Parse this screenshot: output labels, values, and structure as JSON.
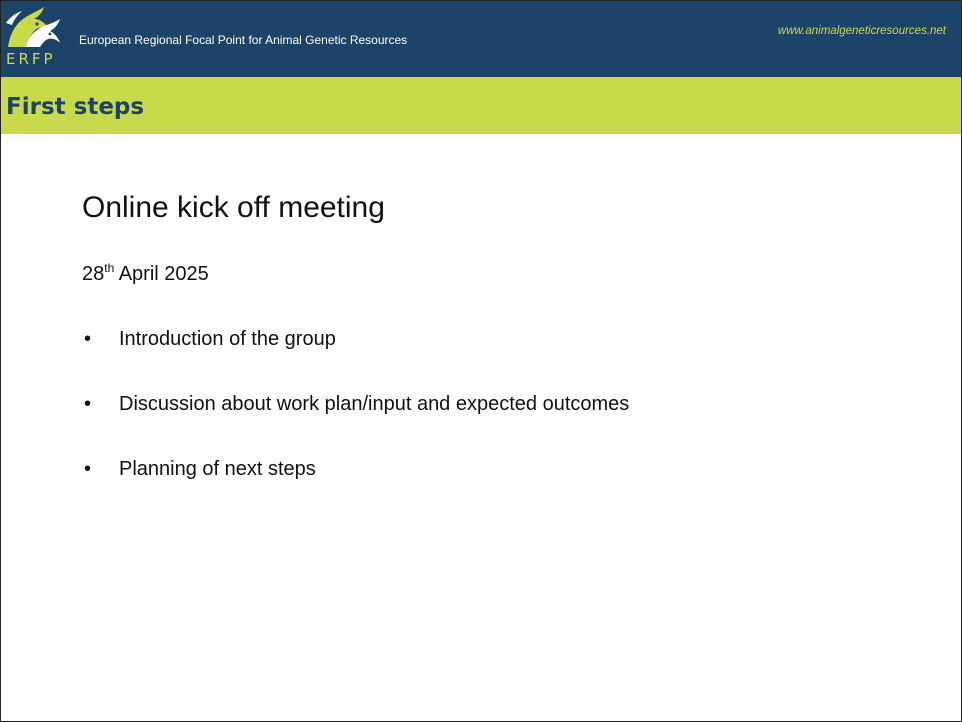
{
  "colors": {
    "header_background": "#1c4469",
    "accent": "#c8d94a",
    "title_text": "#1c4469",
    "body_text": "#111111"
  },
  "header": {
    "logo_icon": "erfp-horse-logo-icon",
    "logo_text": "ERFP",
    "org_name": "European Regional Focal Point for Animal Genetic Resources",
    "website": "www.animalgeneticresources.net"
  },
  "slide": {
    "title": "First steps",
    "heading": "Online kick off meeting",
    "date": {
      "day": "28",
      "suffix": "th",
      "rest": " April 2025"
    },
    "bullet_symbol": "•",
    "bullets": [
      "Introduction of the group",
      "Discussion about work plan/input and expected outcomes",
      "Planning of next steps"
    ]
  }
}
